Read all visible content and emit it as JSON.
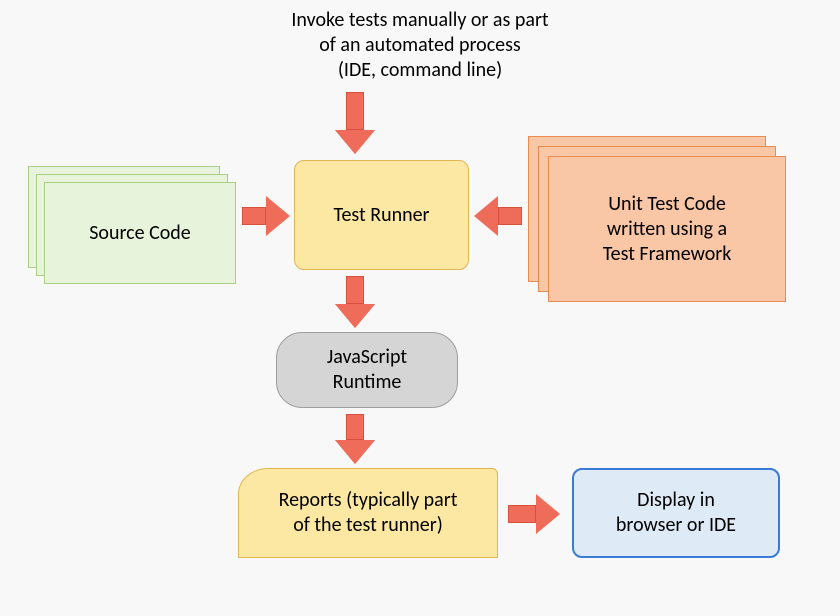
{
  "top_text": {
    "line1": "Invoke tests manually or as part",
    "line2": "of an automated process",
    "line3": "(IDE, command line)"
  },
  "source_code": {
    "label": "Source Code"
  },
  "test_runner": {
    "label": "Test Runner"
  },
  "unit_test_code": {
    "line1": "Unit Test Code",
    "line2": "written using a",
    "line3": "Test Framework"
  },
  "js_runtime": {
    "line1": "JavaScript",
    "line2": "Runtime"
  },
  "reports": {
    "line1": "Reports (typically part",
    "line2": "of the test runner)"
  },
  "display": {
    "line1": "Display in",
    "line2": "browser or IDE"
  }
}
